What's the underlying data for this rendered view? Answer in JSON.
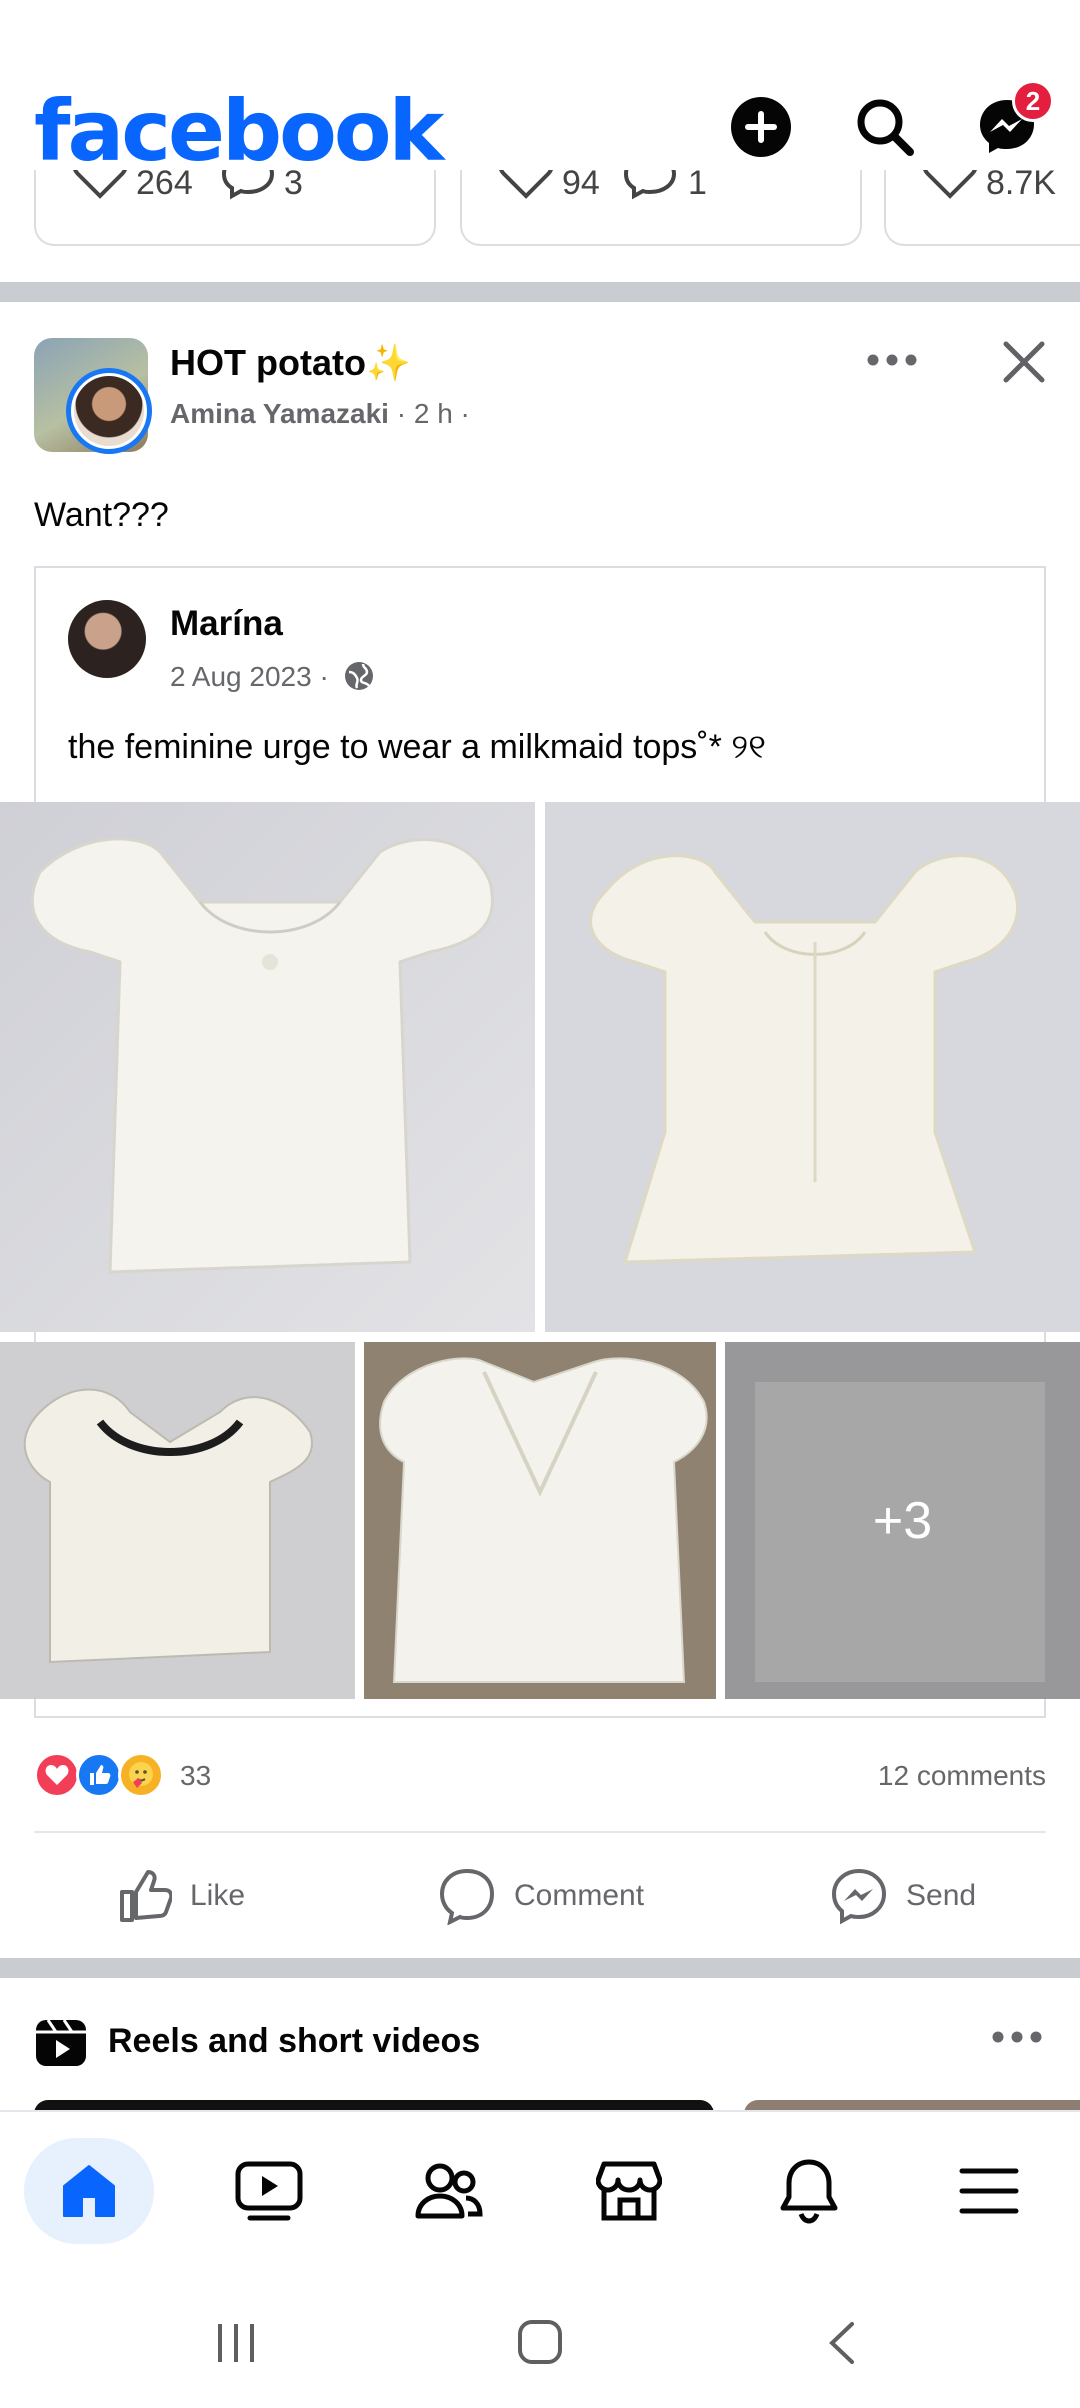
{
  "header": {
    "logo": "facebook",
    "messenger_badge": "2"
  },
  "story_strip": [
    {
      "likes": "264",
      "comments": "3"
    },
    {
      "likes": "94",
      "comments": "1"
    },
    {
      "likes": "8.7K"
    }
  ],
  "post": {
    "group_name": "HOT potato✨",
    "author": "Amina Yamazaki",
    "time": "2 h",
    "text": "Want???",
    "shared": {
      "author": "Marína",
      "date": "2 Aug 2023",
      "text": "the feminine urge to wear a milkmaid tops˚* ୨୧"
    },
    "more_photos": "+3",
    "reaction_count": "33",
    "comments": "12 comments",
    "actions": {
      "like": "Like",
      "comment": "Comment",
      "send": "Send"
    }
  },
  "reels": {
    "title": "Reels and short videos"
  },
  "colors": {
    "brand": "#0866ff",
    "badge": "#e41e3f",
    "nav_active_bg": "#e7f0fd"
  },
  "bottom_nav": [
    "home-icon",
    "video-icon",
    "friends-icon",
    "marketplace-icon",
    "bell-icon",
    "menu-icon"
  ]
}
